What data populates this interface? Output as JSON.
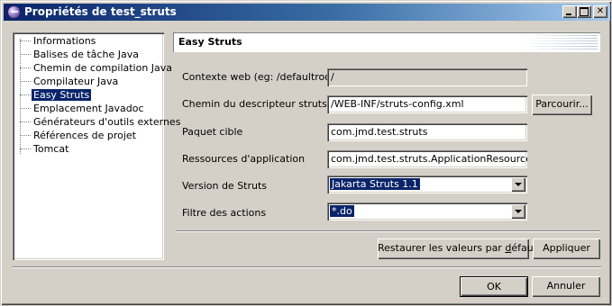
{
  "window": {
    "title": "Propriétés de test_struts",
    "controls": {
      "minimize": "_",
      "maximize": "□",
      "close": "✕"
    }
  },
  "tree": {
    "items": [
      {
        "label": "Informations"
      },
      {
        "label": "Balises de tâche Java"
      },
      {
        "label": "Chemin de compilation Java"
      },
      {
        "label": "Compilateur Java"
      },
      {
        "label": "Easy Struts",
        "selected": true
      },
      {
        "label": "Emplacement Javadoc"
      },
      {
        "label": "Générateurs d'outils externes"
      },
      {
        "label": "Références de projet"
      },
      {
        "label": "Tomcat"
      }
    ]
  },
  "pane": {
    "title": "Easy Struts",
    "fields": {
      "context": {
        "label": "Contexte web (eg: /defaultroot)",
        "value": "/"
      },
      "descriptor": {
        "label": "Chemin du descripteur struts",
        "value": "/WEB-INF/struts-config.xml"
      },
      "package": {
        "label": "Paquet cible",
        "value": "com.jmd.test.struts"
      },
      "resources": {
        "label": "Ressources d'application",
        "value": "com.jmd.test.struts.ApplicationResources"
      },
      "version": {
        "label": "Version de Struts",
        "value": "Jakarta Struts 1.1"
      },
      "filter": {
        "label": "Filtre des actions",
        "value": "*.do"
      }
    },
    "browse_label": "Parcourir...",
    "restore_label_pre": "Restaurer les valeurs par ",
    "restore_label_mnemonic": "d",
    "restore_label_post": "éfaut",
    "apply_label": "Appliquer"
  },
  "footer": {
    "ok_label": "OK",
    "cancel_label": "Annuler"
  }
}
